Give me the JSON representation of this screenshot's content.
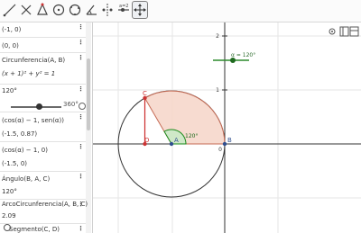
{
  "toolbar": {
    "tools": [
      "move-graphic-tool",
      "point-tool",
      "line-tool",
      "perpendicular-tool",
      "polygon-tool",
      "circle-tool",
      "angle-tool",
      "reflect-tool",
      "slider-tool",
      "move-view-tool"
    ]
  },
  "algebra": {
    "rows": [
      {
        "id": "A",
        "text": "(-1, 0)"
      },
      {
        "id": "B",
        "text": "(0, 0)"
      },
      {
        "id": "c",
        "text": "Circunferencia(A, B)"
      },
      {
        "id": "c_eq",
        "text": "(x + 1)² + y² = 1"
      },
      {
        "id": "alpha",
        "text": "120°"
      },
      {
        "id": "slider_max",
        "text": "360°"
      },
      {
        "id": "C_def",
        "text": "(cos(α) − 1, sen(α))"
      },
      {
        "id": "C_val",
        "text": "(-1.5, 0.87)"
      },
      {
        "id": "D_def",
        "text": "(cos(α) − 1, 0)"
      },
      {
        "id": "D_val",
        "text": "(-1.5, 0)"
      },
      {
        "id": "ang_def",
        "text": "Ángulo(B, A, C)"
      },
      {
        "id": "ang_val",
        "text": "120°"
      },
      {
        "id": "arc_def",
        "text": "ArcoCircunferencia(A, B, C)"
      },
      {
        "id": "arc_val",
        "text": "2.09"
      },
      {
        "id": "seg_def",
        "text": "Segmento(C, D)"
      }
    ]
  },
  "graphics": {
    "slider_label": "α = 120°",
    "points": {
      "A": "A",
      "B": "B",
      "C": "C",
      "D": "D"
    },
    "angle_label": "120°",
    "y_ticks": [
      "2",
      "1"
    ],
    "x_tick_b": "0",
    "colors": {
      "sector_fill": "#f6d5c8",
      "sector_stroke": "#c66b55",
      "angle": "#1a8a1a",
      "segment": "#cc2a2a",
      "slider": "#2b8a2b",
      "point": "#2f4f8f"
    }
  }
}
